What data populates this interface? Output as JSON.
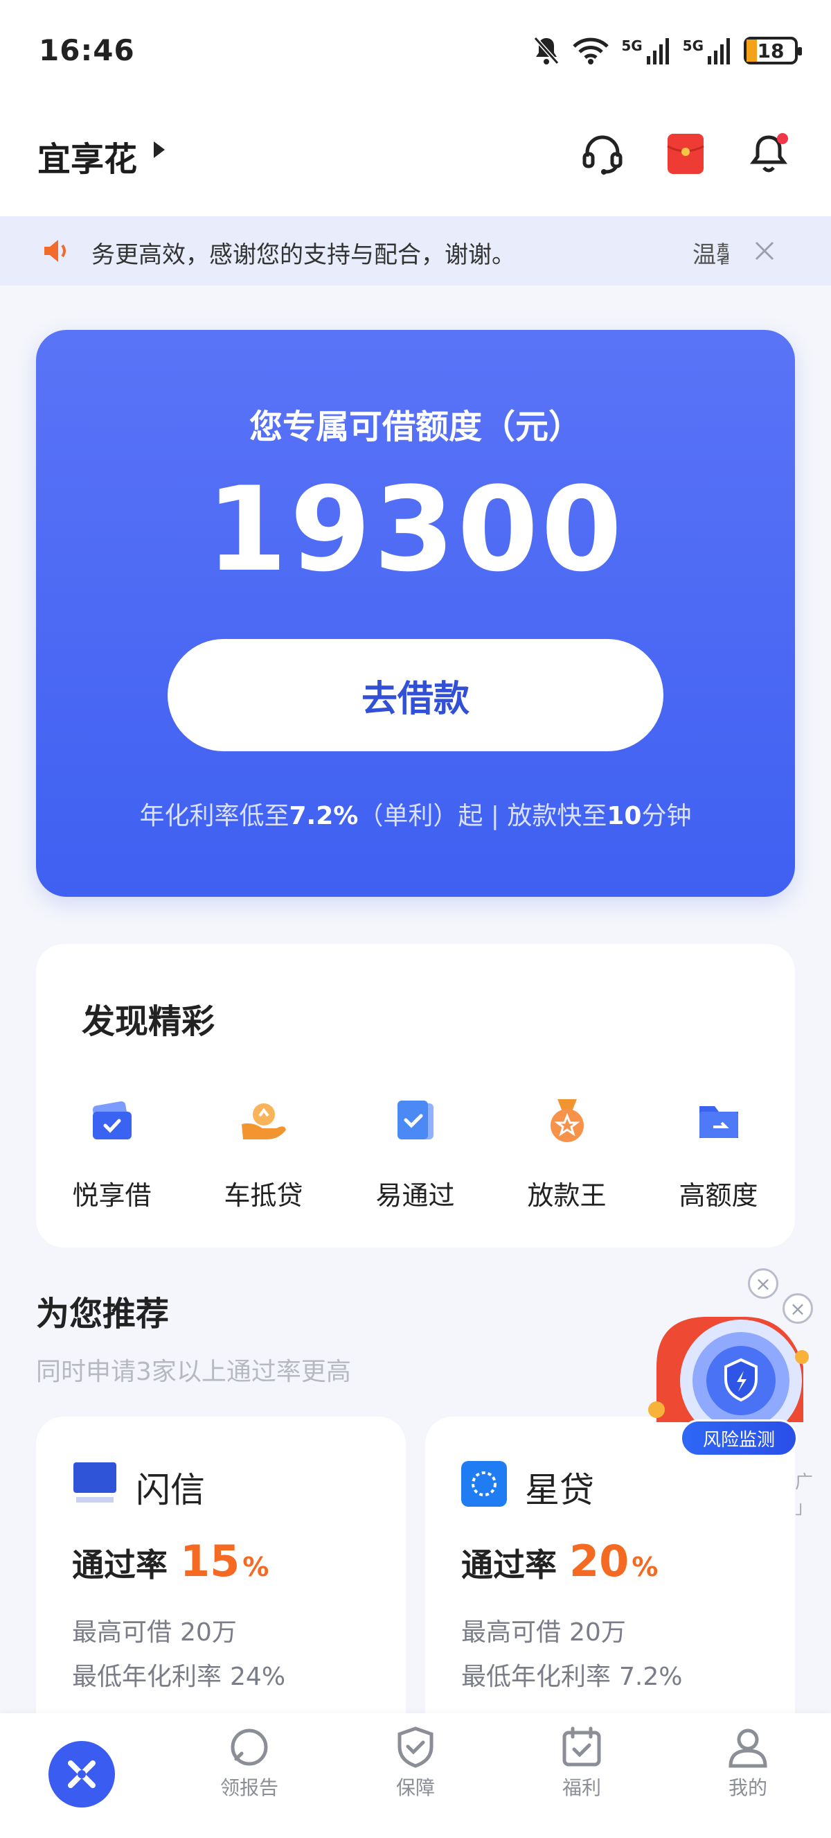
{
  "status_bar": {
    "time": "16:46",
    "battery": "18",
    "signal_1_label": "5G",
    "signal_2_label": "5G",
    "icons": [
      "mute-bell-icon",
      "wifi-icon",
      "signal-5g-icon",
      "signal-5g-icon",
      "battery-icon"
    ]
  },
  "header": {
    "title": "宜享花",
    "icons": [
      "headset-icon",
      "red-packet-icon",
      "bell-icon"
    ]
  },
  "notice": {
    "text": "务更高效，感谢您的支持与配合，谢谢。",
    "tail_text": "温馨"
  },
  "credit": {
    "label": "您专属可借额度（元）",
    "amount": "19300",
    "button": "去借款",
    "footnote_part1": "年化利率低至",
    "rate": "7.2%",
    "footnote_part2": "（单利）起 | 放款快至",
    "minutes": "10",
    "footnote_part3": "分钟"
  },
  "discover": {
    "title": "发现精彩",
    "items": [
      {
        "label": "悦享借",
        "icon": "wallet-check-icon"
      },
      {
        "label": "车抵贷",
        "icon": "hand-coin-icon"
      },
      {
        "label": "易通过",
        "icon": "document-check-icon"
      },
      {
        "label": "放款王",
        "icon": "medal-icon"
      },
      {
        "label": "高额度",
        "icon": "folder-icon"
      }
    ]
  },
  "recommend": {
    "title": "为您推荐",
    "subtitle": "同时申请3家以上通过率更高",
    "ad_label": "「广告」",
    "products": [
      {
        "name": "闪信",
        "logo_text": "闪信",
        "pass_label": "通过率",
        "pass_rate": "15",
        "pass_unit": "%",
        "max_label": "最高可借",
        "max_value": "20万",
        "rate_label": "最低年化利率",
        "rate_value": "24%"
      },
      {
        "name": "星贷",
        "logo_text": "",
        "pass_label": "通过率",
        "pass_rate": "20",
        "pass_unit": "%",
        "max_label": "最高可借",
        "max_value": "20万",
        "rate_label": "最低年化利率",
        "rate_value": "7.2%"
      }
    ]
  },
  "float_widget": {
    "label": "风险监测"
  },
  "bottom_nav": {
    "items": [
      {
        "label": "",
        "icon": "home-logo-icon"
      },
      {
        "label": "领报告",
        "icon": "report-icon"
      },
      {
        "label": "保障",
        "icon": "shield-icon"
      },
      {
        "label": "福利",
        "icon": "calendar-icon"
      },
      {
        "label": "我的",
        "icon": "profile-icon"
      }
    ]
  },
  "colors": {
    "accent_blue": "#3f60f1",
    "rate_orange": "#f56a22",
    "notice_bg": "#e9edfb"
  }
}
